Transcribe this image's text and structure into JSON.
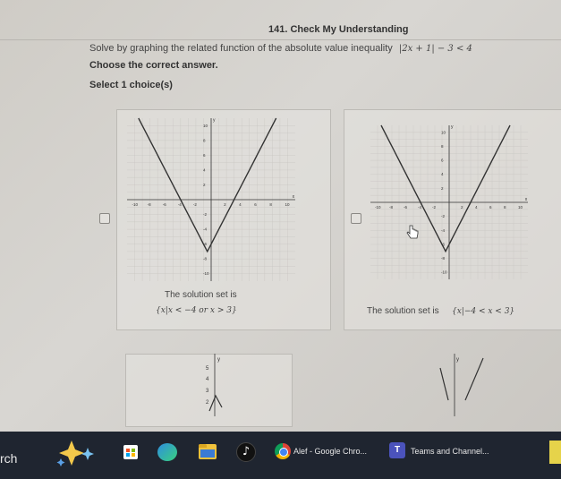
{
  "question": {
    "title": "141. Check My Understanding",
    "prompt": "Solve by graphing the related function of the absolute value inequality",
    "inequality": "|2x + 1| − 3 < 4",
    "instruction": "Choose the correct answer.",
    "select_label": "Select 1 choice(s)"
  },
  "choices": [
    {
      "solution_prefix": "The solution set is",
      "solution_set": "{x|x < −4 or x > 3}",
      "graph": {
        "x_ticks": [
          "-10",
          "-8",
          "-6",
          "-4",
          "-2",
          "2",
          "4",
          "6",
          "8",
          "10"
        ],
        "y_ticks": [
          "10",
          "8",
          "6",
          "4",
          "2",
          "-2",
          "-4",
          "-6",
          "-8",
          "-10"
        ],
        "axis_x": "x",
        "axis_y": "y"
      }
    },
    {
      "solution_prefix": "The solution set is",
      "solution_set": "{x|−4 < x < 3}",
      "graph": {
        "x_ticks": [
          "-10",
          "-8",
          "-6",
          "-4",
          "-2",
          "2",
          "4",
          "6",
          "8",
          "10"
        ],
        "y_ticks": [
          "10",
          "8",
          "6",
          "4",
          "2",
          "-2",
          "-4",
          "-6",
          "-8",
          "-10"
        ],
        "axis_x": "x",
        "axis_y": "y"
      }
    },
    {
      "graph": {
        "y_ticks": [
          "5",
          "4",
          "3",
          "2"
        ],
        "axis_y": "y"
      }
    },
    {
      "graph": {
        "axis_y": "y"
      }
    }
  ],
  "taskbar": {
    "search_text": "rch",
    "chrome_label": "Alef - Google Chro...",
    "teams_label": "Teams and Channel..."
  },
  "colors": {
    "taskbar_bg": "#1f2530",
    "graph_line": "#333333",
    "grid": "#c9c7c3"
  }
}
